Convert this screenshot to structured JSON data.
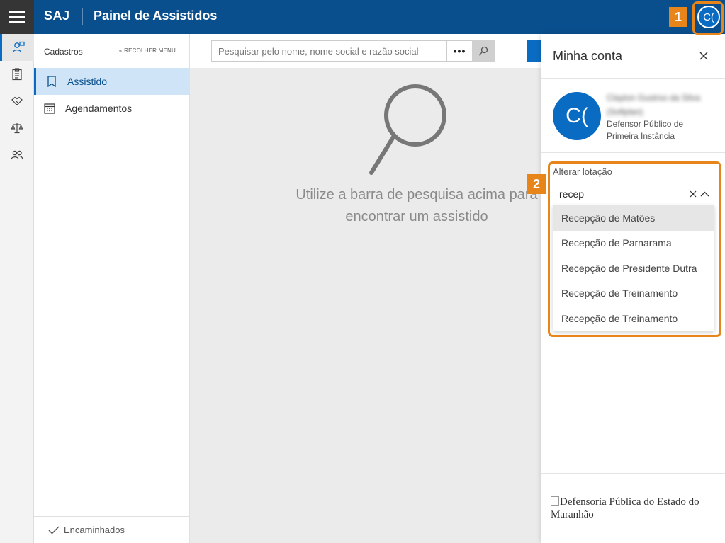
{
  "header": {
    "brand": "SAJ",
    "title": "Painel de Assistidos",
    "account_initials": "C("
  },
  "rail": {
    "items": [
      {
        "icon": "person-search-icon",
        "active": true
      },
      {
        "icon": "clipboard-icon",
        "active": false
      },
      {
        "icon": "handshake-icon",
        "active": false
      },
      {
        "icon": "scales-icon",
        "active": false
      },
      {
        "icon": "people-icon",
        "active": false
      }
    ]
  },
  "sidebar": {
    "heading": "Cadastros",
    "collapse_label": "RECOLHER MENU",
    "items": [
      {
        "label": "Assistido",
        "icon": "bookmark-icon",
        "active": true
      },
      {
        "label": "Agendamentos",
        "icon": "calendar-icon",
        "active": false
      }
    ],
    "footer_label": "Encaminhados"
  },
  "search": {
    "placeholder": "Pesquisar pelo nome, nome social e razão social",
    "more_label": "•••"
  },
  "main": {
    "empty_line1": "Utilize a barra de pesquisa acima para",
    "empty_line2": "encontrar um assistido"
  },
  "account_panel": {
    "title": "Minha conta",
    "avatar_initials": "C(",
    "user_name": "Clayton Gustrso da Silva (Sofiplan)",
    "user_role": "Defensor Público de Primeira Instância",
    "location_label": "Alterar lotação",
    "location_query": "recep",
    "options": [
      "Recepção de Matões",
      "Recepção de Parnarama",
      "Recepção de Presidente Dutra",
      "Recepção de Treinamento",
      "Recepção de Treinamento"
    ],
    "logo_alt": "Defensoria Pública do Estado do Maranhão"
  },
  "callouts": [
    "1",
    "2"
  ],
  "colors": {
    "header_bg": "#0a4f8d",
    "accent": "#0a6bc2",
    "callout": "#e8851a",
    "active_item_bg": "#cfe4f6"
  }
}
